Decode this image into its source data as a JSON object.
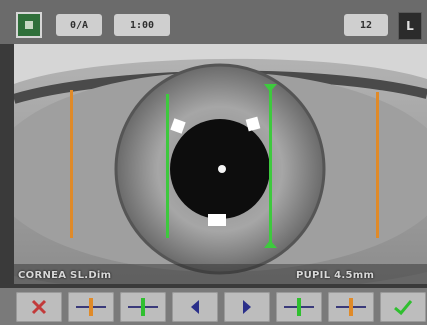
{
  "topbar": {
    "chip_a": "0/A",
    "chip_b": "1:00",
    "chip_c": "12",
    "eye_side": "L"
  },
  "readouts": {
    "left": "CORNEA  SL.Dim",
    "right": "PUPIL  4.5mm"
  },
  "toolbar": {
    "buttons": [
      {
        "icon": "cancel-icon",
        "color": "#c23a3a"
      },
      {
        "icon": "caliper-orange-icon",
        "color": "#e08a28"
      },
      {
        "icon": "caliper-green-icon",
        "color": "#2fbf2f"
      },
      {
        "icon": "arrow-left-icon",
        "color": "#2a2f8a"
      },
      {
        "icon": "arrow-right-icon",
        "color": "#2a2f8a"
      },
      {
        "icon": "caliper-green-icon",
        "color": "#2fbf2f"
      },
      {
        "icon": "caliper-orange-icon",
        "color": "#e08a28"
      },
      {
        "icon": "confirm-icon",
        "color": "#2fbf2f"
      }
    ]
  },
  "colors": {
    "cornea_marker": "#e08a28",
    "pupil_marker": "#3ec93e",
    "accent_green": "#2f6f3a"
  }
}
